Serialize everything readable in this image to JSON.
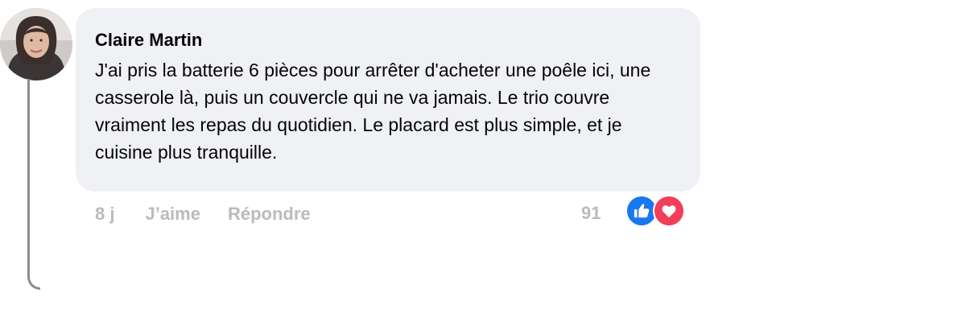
{
  "comment": {
    "author": "Claire Martin",
    "avatar_icon": "user-avatar-photo",
    "text": "J'ai pris la batterie 6 pièces pour arrêter d'acheter une poêle ici, une casserole là, puis un couvercle qui ne va jamais. Le trio couvre vraiment les repas du quotidien. Le placard est plus simple, et je cuisine plus tranquille.",
    "timestamp": "8 j",
    "like_label": "J’aime",
    "reply_label": "Répondre",
    "reaction_count": "91",
    "reactions": [
      "like-icon",
      "love-icon"
    ]
  },
  "colors": {
    "bubble_bg": "#f0f1f4",
    "action_text": "#b9bbbf",
    "like": "#1877f2",
    "love": "#f33e58",
    "thread_line": "#8a8d91"
  }
}
